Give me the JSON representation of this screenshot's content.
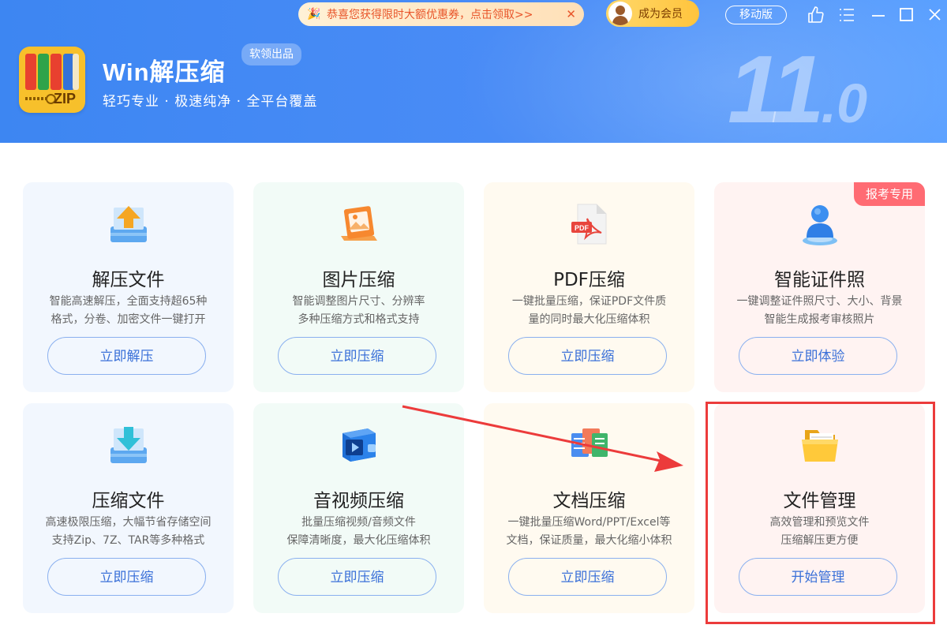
{
  "header": {
    "promo_text": "恭喜您获得限时大额优惠券，点击领取>>",
    "promo_close": "✕",
    "vip_label": "成为会员",
    "mobile_label": "移动版",
    "app_name": "Win解压缩",
    "app_badge": "软领出品",
    "slogan": "轻巧专业 · 极速纯净 · 全平台覆盖",
    "version_major": "11",
    "version_minor": ".0",
    "logo_text": "ZIP"
  },
  "colors": {
    "header_start": "#3d86f2",
    "header_end": "#5aa0ff",
    "button_border": "#8ab0ef",
    "button_text": "#3a70d8",
    "highlight": "#ec3b3b",
    "tag_bg": "#ff6b73"
  },
  "cards": [
    {
      "title": "解压文件",
      "desc1": "智能高速解压，全面支持超65种",
      "desc2": "格式，分卷、加密文件一键打开",
      "button": "立即解压",
      "icon": "extract-icon"
    },
    {
      "title": "图片压缩",
      "desc1": "智能调整图片尺寸、分辨率",
      "desc2": "多种压缩方式和格式支持",
      "button": "立即压缩",
      "icon": "image-icon"
    },
    {
      "title": "PDF压缩",
      "desc1": "一键批量压缩，保证PDF文件质",
      "desc2": "量的同时最大化压缩体积",
      "button": "立即压缩",
      "icon": "pdf-icon",
      "icon_text": "PDF"
    },
    {
      "title": "智能证件照",
      "desc1": "一键调整证件照尺寸、大小、背景",
      "desc2": "智能生成报考审核照片",
      "button": "立即体验",
      "icon": "id-photo-icon",
      "tag": "报考专用"
    },
    {
      "title": "压缩文件",
      "desc1": "高速极限压缩，大幅节省存储空间",
      "desc2": "支持Zip、7Z、TAR等多种格式",
      "button": "立即压缩",
      "icon": "compress-icon"
    },
    {
      "title": "音视频压缩",
      "desc1": "批量压缩视频/音频文件",
      "desc2": "保障清晰度，最大化压缩体积",
      "button": "立即压缩",
      "icon": "video-icon"
    },
    {
      "title": "文档压缩",
      "desc1": "一键批量压缩Word/PPT/Excel等",
      "desc2": "文档，保证质量，最大化缩小体积",
      "button": "立即压缩",
      "icon": "document-icon"
    },
    {
      "title": "文件管理",
      "desc1": "高效管理和预览文件",
      "desc2": "压缩解压更方便",
      "button": "开始管理",
      "icon": "folder-icon"
    }
  ]
}
